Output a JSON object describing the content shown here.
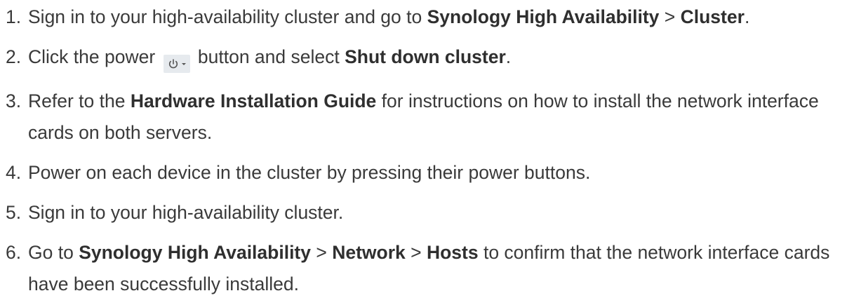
{
  "steps": [
    {
      "num": "1.",
      "t1": "Sign in to your high-availability cluster and go to ",
      "b1": "Synology High Availability",
      "sep1": " > ",
      "b2": "Cluster",
      "end": "."
    },
    {
      "num": "2.",
      "t1": "Click the power ",
      "icon": "power-dropdown-icon",
      "t2": " button and select ",
      "b1": "Shut down cluster",
      "end": "."
    },
    {
      "num": "3.",
      "t1": "Refer to the ",
      "b1": "Hardware Installation Guide",
      "t2": " for instructions on how to install the network interface cards on both servers."
    },
    {
      "num": "4.",
      "t1": "Power on each device in the cluster by pressing their power buttons."
    },
    {
      "num": "5.",
      "t1": "Sign in to your high-availability cluster."
    },
    {
      "num": "6.",
      "t1": "Go to ",
      "b1": "Synology High Availability",
      "sep1": " > ",
      "b2": "Network",
      "sep2": " > ",
      "b3": "Hosts",
      "t2": " to confirm that the network interface cards have been successfully installed."
    }
  ]
}
